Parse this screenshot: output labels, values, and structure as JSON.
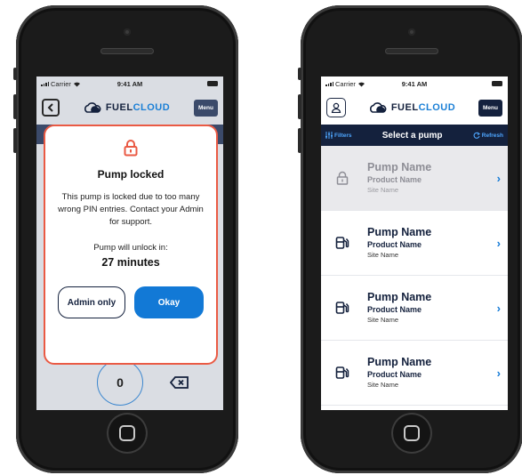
{
  "status_bar": {
    "carrier": "Carrier",
    "time": "9:41 AM"
  },
  "brand": {
    "logo_left": "FUEL",
    "logo_right": "CLOUD",
    "menu_label": "Menu"
  },
  "lock_modal": {
    "title": "Pump locked",
    "message": "This pump is locked due to too many wrong PIN entries. Contact your Admin for support.",
    "unlock_label": "Pump will unlock in:",
    "unlock_time": "27 minutes",
    "admin_button": "Admin only",
    "okay_button": "Okay"
  },
  "keypad": {
    "zero_key": "0"
  },
  "pump_list": {
    "filters_label": "Filters",
    "title": "Select a pump",
    "refresh_label": "Refresh",
    "pumps": [
      {
        "name": "Pump Name",
        "product": "Product Name",
        "site": "Site Name",
        "status": "locked"
      },
      {
        "name": "Pump Name",
        "product": "Product Name",
        "site": "Site Name",
        "status": "available"
      },
      {
        "name": "Pump Name",
        "product": "Product Name",
        "site": "Site Name",
        "status": "available"
      },
      {
        "name": "Pump Name",
        "product": "Product Name",
        "site": "Site Name",
        "status": "available"
      }
    ]
  },
  "colors": {
    "navy": "#14213d",
    "accent_blue": "#1279d6",
    "alert_red": "#ea5a44"
  }
}
